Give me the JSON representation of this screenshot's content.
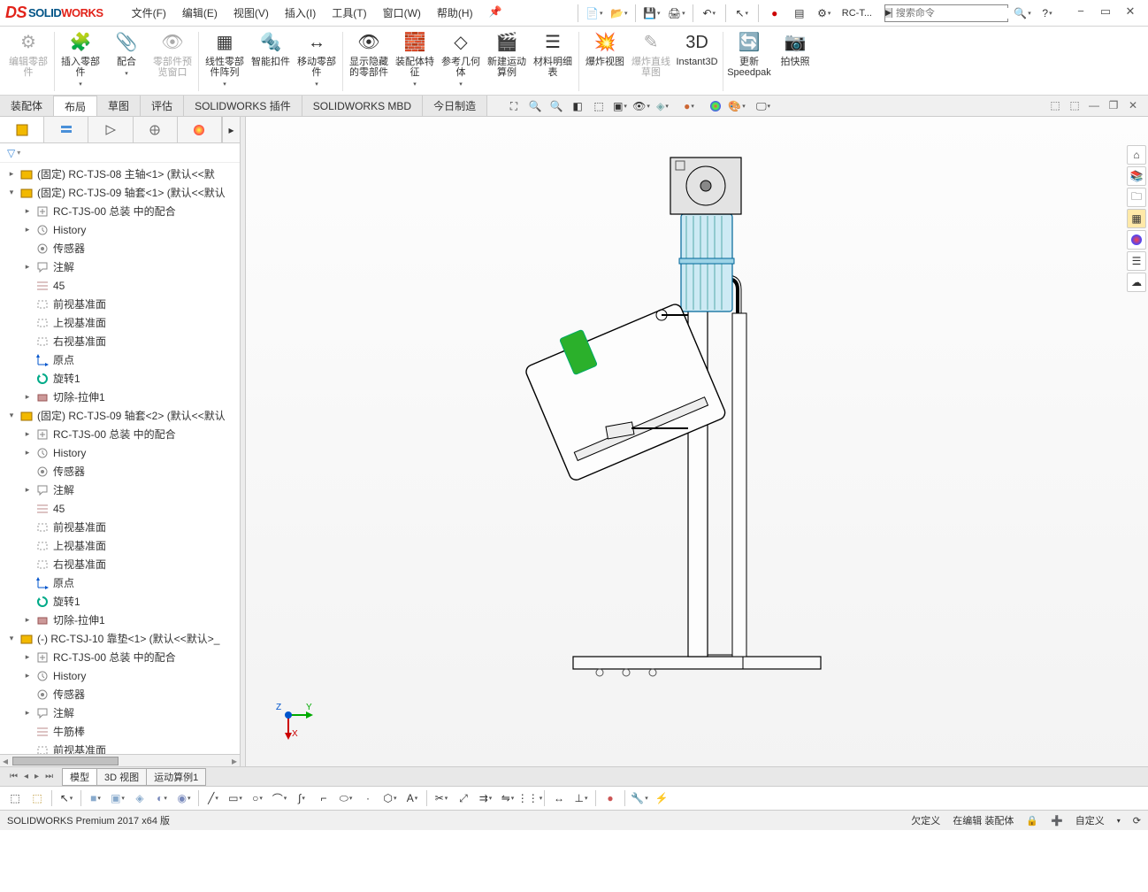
{
  "app": {
    "solid": "SOLID",
    "works": "WORKS"
  },
  "menu": [
    "文件(F)",
    "编辑(E)",
    "视图(V)",
    "插入(I)",
    "工具(T)",
    "窗口(W)",
    "帮助(H)"
  ],
  "qat": {
    "pin": "📌",
    "doc_name": "RC-T..."
  },
  "search": {
    "placeholder": "搜索命令"
  },
  "ribbon": [
    {
      "label": "编辑零部件",
      "disabled": true
    },
    {
      "label": "插入零部件"
    },
    {
      "label": "配合"
    },
    {
      "label": "零部件预览窗口",
      "disabled": true
    },
    {
      "label": "线性零部件阵列"
    },
    {
      "label": "智能扣件"
    },
    {
      "label": "移动零部件"
    },
    {
      "label": "显示隐藏的零部件"
    },
    {
      "label": "装配体特征"
    },
    {
      "label": "参考几何体"
    },
    {
      "label": "新建运动算例"
    },
    {
      "label": "材料明细表"
    },
    {
      "label": "爆炸视图"
    },
    {
      "label": "爆炸直线草图",
      "disabled": true
    },
    {
      "label": "Instant3D"
    },
    {
      "label": "更新Speedpak"
    },
    {
      "label": "拍快照"
    }
  ],
  "tabs": [
    "装配体",
    "布局",
    "草图",
    "评估",
    "SOLIDWORKS 插件",
    "SOLIDWORKS MBD",
    "今日制造"
  ],
  "active_tab_index": 1,
  "tree": [
    {
      "ind": 0,
      "exp": "▸",
      "ico": "part-y",
      "txt": "(固定) RC-TJS-08 主轴<1> (默认<<默"
    },
    {
      "ind": 0,
      "exp": "▾",
      "ico": "part-y",
      "txt": "(固定) RC-TJS-09 轴套<1> (默认<<默认"
    },
    {
      "ind": 1,
      "exp": "▸",
      "ico": "mate",
      "txt": "RC-TJS-00 总装 中的配合"
    },
    {
      "ind": 1,
      "exp": "▸",
      "ico": "hist",
      "txt": "History"
    },
    {
      "ind": 1,
      "exp": "",
      "ico": "sens",
      "txt": "传感器"
    },
    {
      "ind": 1,
      "exp": "▸",
      "ico": "annot",
      "txt": "注解"
    },
    {
      "ind": 1,
      "exp": "",
      "ico": "mat",
      "txt": "45"
    },
    {
      "ind": 1,
      "exp": "",
      "ico": "plane",
      "txt": "前视基准面"
    },
    {
      "ind": 1,
      "exp": "",
      "ico": "plane",
      "txt": "上视基准面"
    },
    {
      "ind": 1,
      "exp": "",
      "ico": "plane",
      "txt": "右视基准面"
    },
    {
      "ind": 1,
      "exp": "",
      "ico": "orig",
      "txt": "原点"
    },
    {
      "ind": 1,
      "exp": "",
      "ico": "rev",
      "txt": "旋转1"
    },
    {
      "ind": 1,
      "exp": "▸",
      "ico": "cut",
      "txt": "切除-拉伸1"
    },
    {
      "ind": 0,
      "exp": "▾",
      "ico": "part-y",
      "txt": "(固定) RC-TJS-09 轴套<2> (默认<<默认"
    },
    {
      "ind": 1,
      "exp": "▸",
      "ico": "mate",
      "txt": "RC-TJS-00 总装 中的配合"
    },
    {
      "ind": 1,
      "exp": "▸",
      "ico": "hist",
      "txt": "History"
    },
    {
      "ind": 1,
      "exp": "",
      "ico": "sens",
      "txt": "传感器"
    },
    {
      "ind": 1,
      "exp": "▸",
      "ico": "annot",
      "txt": "注解"
    },
    {
      "ind": 1,
      "exp": "",
      "ico": "mat",
      "txt": "45"
    },
    {
      "ind": 1,
      "exp": "",
      "ico": "plane",
      "txt": "前视基准面"
    },
    {
      "ind": 1,
      "exp": "",
      "ico": "plane",
      "txt": "上视基准面"
    },
    {
      "ind": 1,
      "exp": "",
      "ico": "plane",
      "txt": "右视基准面"
    },
    {
      "ind": 1,
      "exp": "",
      "ico": "orig",
      "txt": "原点"
    },
    {
      "ind": 1,
      "exp": "",
      "ico": "rev",
      "txt": "旋转1"
    },
    {
      "ind": 1,
      "exp": "▸",
      "ico": "cut",
      "txt": "切除-拉伸1"
    },
    {
      "ind": 0,
      "exp": "▾",
      "ico": "part-y",
      "txt": "(-) RC-TSJ-10 靠垫<1> (默认<<默认>_"
    },
    {
      "ind": 1,
      "exp": "▸",
      "ico": "mate",
      "txt": "RC-TJS-00 总装 中的配合"
    },
    {
      "ind": 1,
      "exp": "▸",
      "ico": "hist",
      "txt": "History"
    },
    {
      "ind": 1,
      "exp": "",
      "ico": "sens",
      "txt": "传感器"
    },
    {
      "ind": 1,
      "exp": "▸",
      "ico": "annot",
      "txt": "注解"
    },
    {
      "ind": 1,
      "exp": "",
      "ico": "mat",
      "txt": "牛筋棒"
    },
    {
      "ind": 1,
      "exp": "",
      "ico": "plane",
      "txt": "前视基准面"
    }
  ],
  "bottom_tabs": [
    "模型",
    "3D 视图",
    "运动算例1"
  ],
  "triad": {
    "z": "Z",
    "y": "Y",
    "x": "X"
  },
  "status": {
    "left": "SOLIDWORKS Premium 2017 x64 版",
    "def": "欠定义",
    "edit": "在编辑 装配体",
    "custom": "自定义"
  }
}
